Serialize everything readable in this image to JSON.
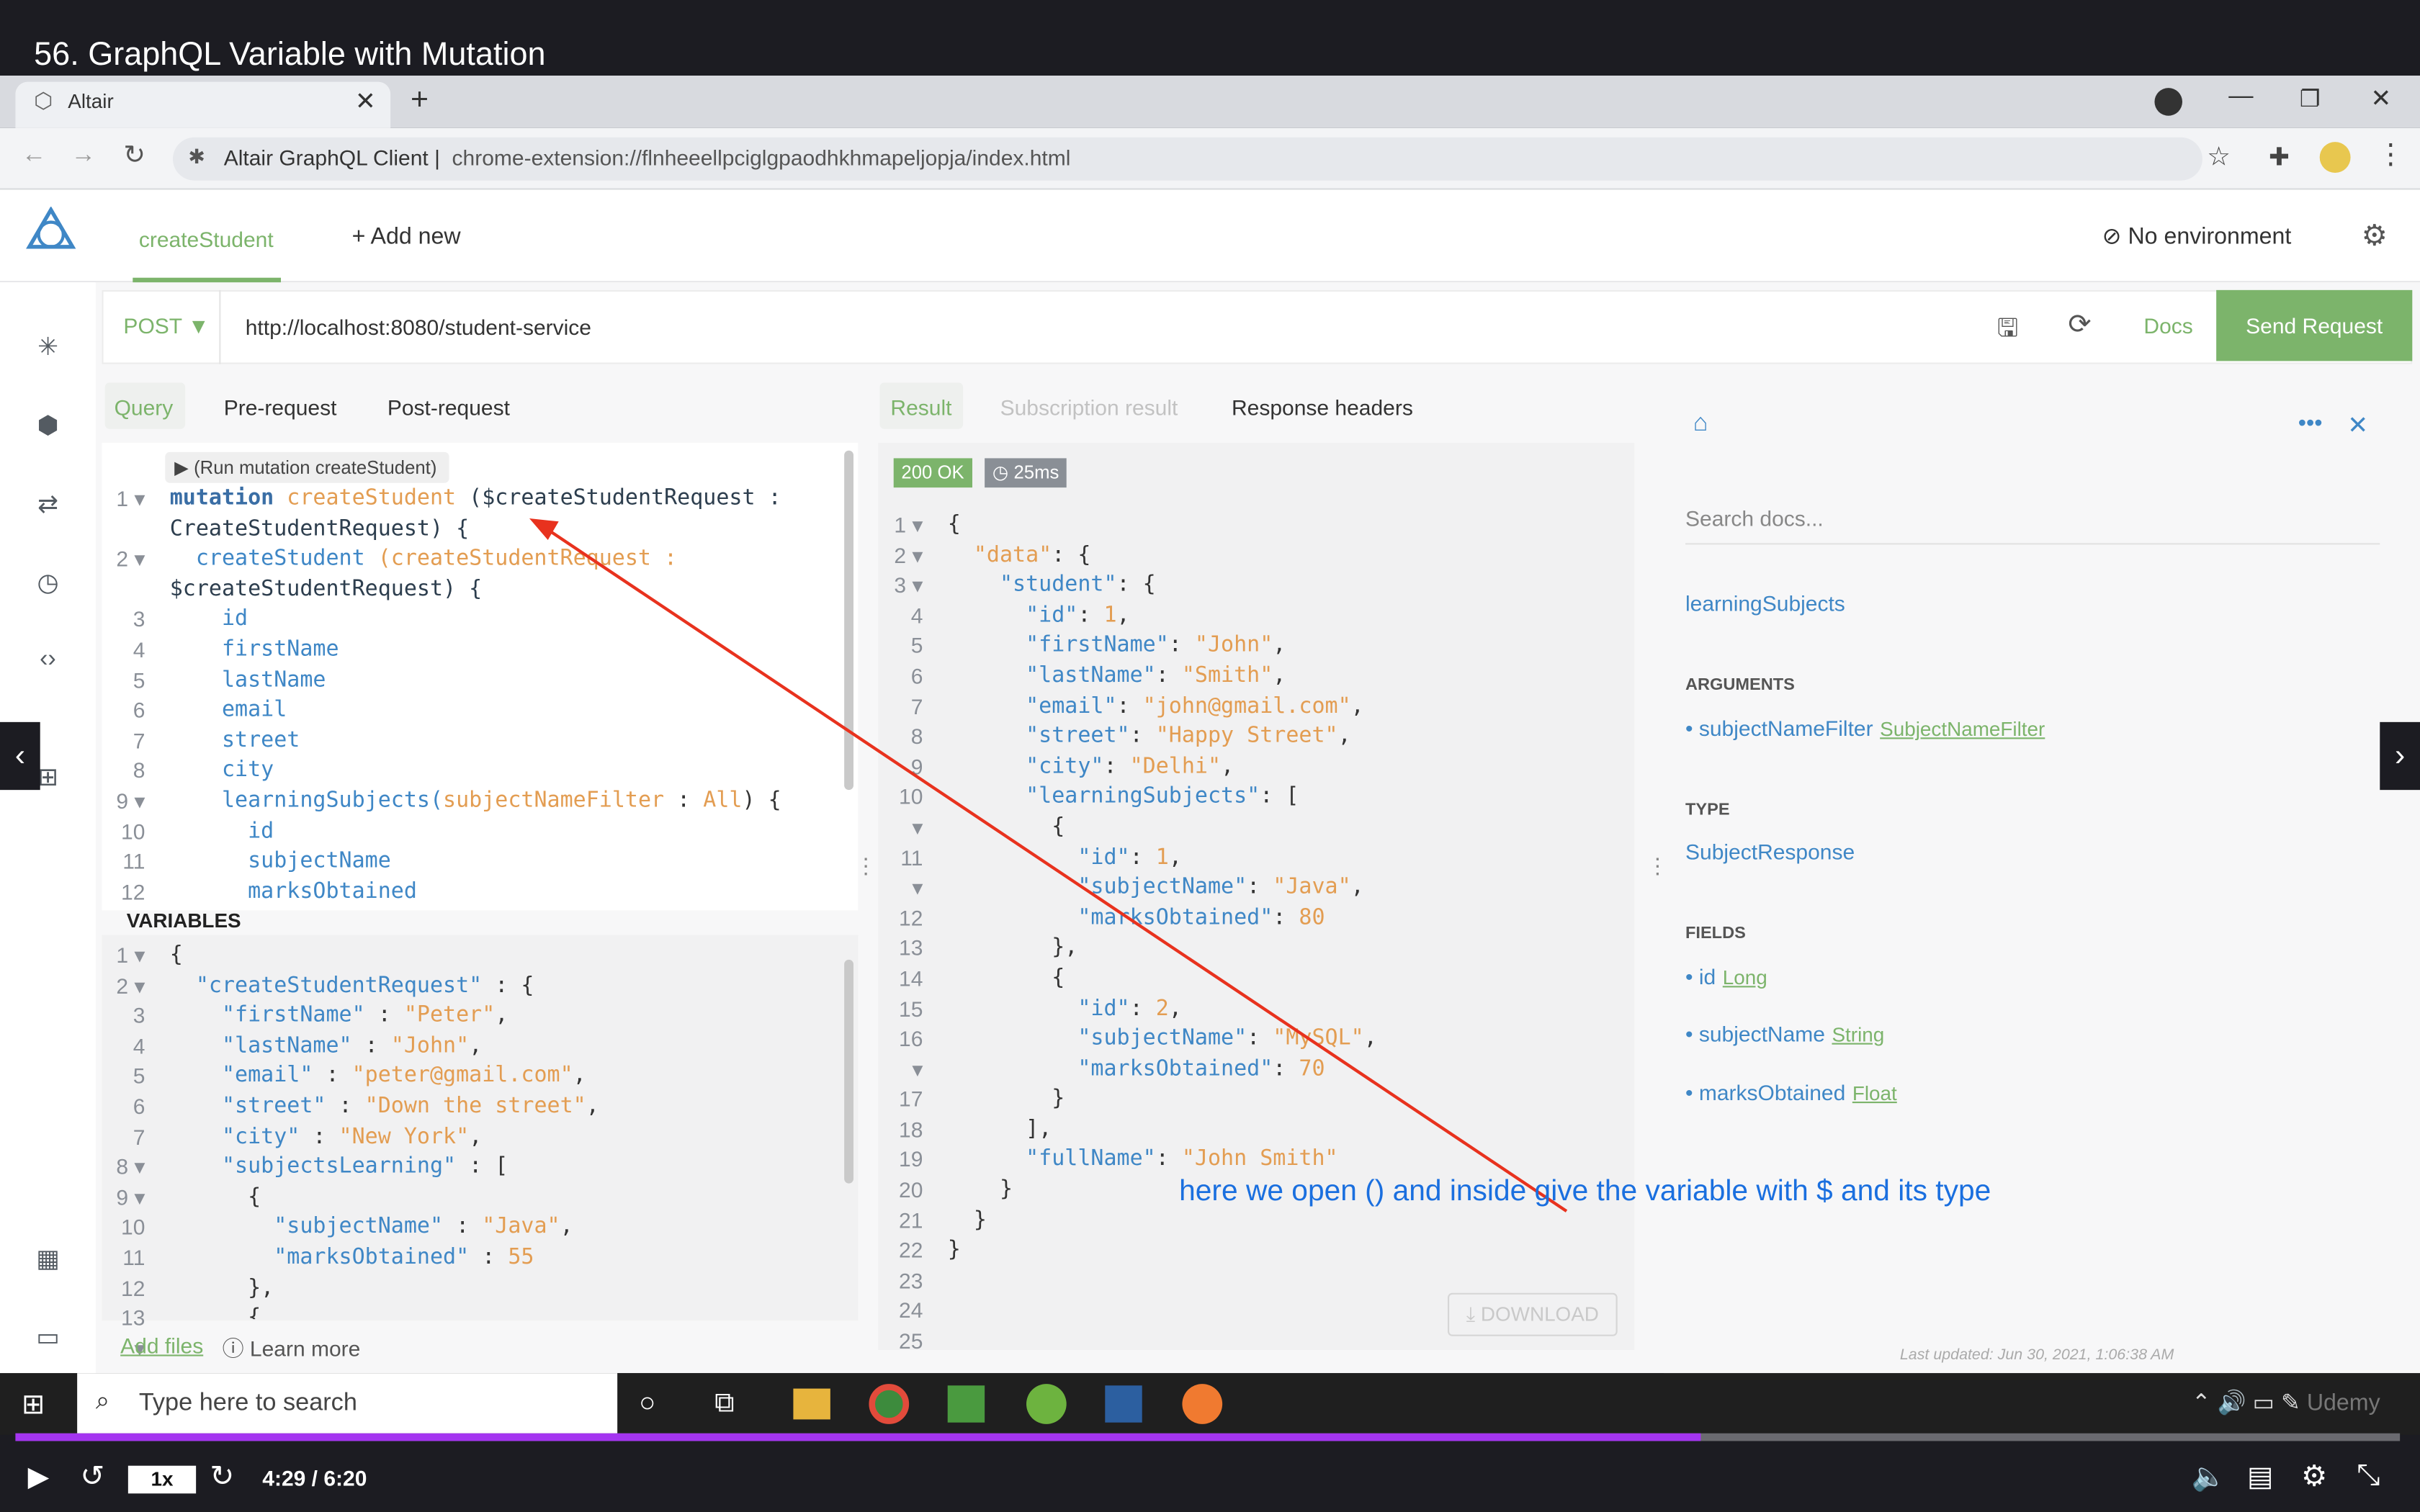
{
  "video": {
    "title": "56. GraphQL Variable with Mutation"
  },
  "browser": {
    "tab_title": "Altair",
    "site_label": "Altair GraphQL Client",
    "url": "chrome-extension://flnheeellpciglgpaodhkhmapeljopja/index.html"
  },
  "app": {
    "window_tab": "createStudent",
    "add_new": "+ Add new",
    "environment": "No environment",
    "method": "POST",
    "endpoint": "http://localhost:8080/student-service",
    "docs": "Docs",
    "send": "Send Request",
    "left_tabs": [
      "Query",
      "Pre-request",
      "Post-request"
    ],
    "right_tabs": [
      "Result",
      "Subscription result",
      "Response headers"
    ],
    "run_hint": "(Run mutation createStudent)",
    "variables_label": "VARIABLES",
    "add_files": "Add files",
    "learn_more": "Learn more",
    "status": "200 OK",
    "time": "25ms",
    "download": "DOWNLOAD"
  },
  "query_lines": [
    [
      {
        "t": "mutation ",
        "c": "kw"
      },
      {
        "t": "createStudent ",
        "c": "fn"
      },
      {
        "t": "($createStudentRequest :",
        "c": "var"
      }
    ],
    [
      {
        "t": "CreateStudentRequest) {",
        "c": "var"
      }
    ],
    [
      {
        "t": "  createStudent ",
        "c": "fld"
      },
      {
        "t": "(createStudentRequest :",
        "c": "fn"
      }
    ],
    [
      {
        "t": "$createStudentRequest) {",
        "c": "var"
      }
    ],
    [
      {
        "t": "    id",
        "c": "fld"
      }
    ],
    [
      {
        "t": "    firstName",
        "c": "fld"
      }
    ],
    [
      {
        "t": "    lastName",
        "c": "fld"
      }
    ],
    [
      {
        "t": "    email",
        "c": "fld"
      }
    ],
    [
      {
        "t": "    street",
        "c": "fld"
      }
    ],
    [
      {
        "t": "    city",
        "c": "fld"
      }
    ],
    [
      {
        "t": "    learningSubjects(",
        "c": "fld"
      },
      {
        "t": "subjectNameFilter",
        "c": "fn"
      },
      {
        "t": " : ",
        "c": "pn"
      },
      {
        "t": "All",
        "c": "fn"
      },
      {
        "t": ") {",
        "c": "pn"
      }
    ],
    [
      {
        "t": "      id",
        "c": "fld"
      }
    ],
    [
      {
        "t": "      subjectName",
        "c": "fld"
      }
    ],
    [
      {
        "t": "      marksObtained",
        "c": "fld"
      }
    ]
  ],
  "query_gutter": [
    "1 ▾",
    "",
    "2 ▾",
    "",
    "3",
    "4",
    "5",
    "6",
    "7",
    "8",
    "9 ▾",
    "10",
    "11",
    "12"
  ],
  "var_lines": [
    [
      {
        "t": "{",
        "c": "pn"
      }
    ],
    [
      {
        "t": "  \"createStudentRequest\"",
        "c": "key"
      },
      {
        "t": " : {",
        "c": "pn"
      }
    ],
    [
      {
        "t": "    \"firstName\"",
        "c": "key"
      },
      {
        "t": " : ",
        "c": "pn"
      },
      {
        "t": "\"Peter\"",
        "c": "str"
      },
      {
        "t": ",",
        "c": "pn"
      }
    ],
    [
      {
        "t": "    \"lastName\"",
        "c": "key"
      },
      {
        "t": " : ",
        "c": "pn"
      },
      {
        "t": "\"John\"",
        "c": "str"
      },
      {
        "t": ",",
        "c": "pn"
      }
    ],
    [
      {
        "t": "    \"email\"",
        "c": "key"
      },
      {
        "t": " : ",
        "c": "pn"
      },
      {
        "t": "\"peter@gmail.com\"",
        "c": "str"
      },
      {
        "t": ",",
        "c": "pn"
      }
    ],
    [
      {
        "t": "    \"street\"",
        "c": "key"
      },
      {
        "t": " : ",
        "c": "pn"
      },
      {
        "t": "\"Down the street\"",
        "c": "str"
      },
      {
        "t": ",",
        "c": "pn"
      }
    ],
    [
      {
        "t": "    \"city\"",
        "c": "key"
      },
      {
        "t": " : ",
        "c": "pn"
      },
      {
        "t": "\"New York\"",
        "c": "str"
      },
      {
        "t": ",",
        "c": "pn"
      }
    ],
    [
      {
        "t": "    \"subjectsLearning\"",
        "c": "key"
      },
      {
        "t": " : [",
        "c": "pn"
      }
    ],
    [
      {
        "t": "      {",
        "c": "pn"
      }
    ],
    [
      {
        "t": "        \"subjectName\"",
        "c": "key"
      },
      {
        "t": " : ",
        "c": "pn"
      },
      {
        "t": "\"Java\"",
        "c": "str"
      },
      {
        "t": ",",
        "c": "pn"
      }
    ],
    [
      {
        "t": "        \"marksObtained\"",
        "c": "key"
      },
      {
        "t": " : ",
        "c": "pn"
      },
      {
        "t": "55",
        "c": "num"
      }
    ],
    [
      {
        "t": "      },",
        "c": "pn"
      }
    ],
    [
      {
        "t": "      {",
        "c": "pn"
      }
    ]
  ],
  "var_gutter": [
    "1 ▾",
    "2 ▾",
    "3",
    "4",
    "5",
    "6",
    "7",
    "8 ▾",
    "9 ▾",
    "10",
    "11",
    "12",
    "13 ▾"
  ],
  "result_lines": [
    [
      {
        "t": "{",
        "c": "pn"
      }
    ],
    [
      {
        "t": "  \"data\"",
        "c": "str"
      },
      {
        "t": ": {",
        "c": "pn"
      }
    ],
    [
      {
        "t": "    \"student\"",
        "c": "key"
      },
      {
        "t": ": {",
        "c": "pn"
      }
    ],
    [
      {
        "t": "      \"id\"",
        "c": "key"
      },
      {
        "t": ": ",
        "c": "pn"
      },
      {
        "t": "1",
        "c": "num"
      },
      {
        "t": ",",
        "c": "pn"
      }
    ],
    [
      {
        "t": "      \"firstName\"",
        "c": "key"
      },
      {
        "t": ": ",
        "c": "pn"
      },
      {
        "t": "\"John\"",
        "c": "str"
      },
      {
        "t": ",",
        "c": "pn"
      }
    ],
    [
      {
        "t": "      \"lastName\"",
        "c": "key"
      },
      {
        "t": ": ",
        "c": "pn"
      },
      {
        "t": "\"Smith\"",
        "c": "str"
      },
      {
        "t": ",",
        "c": "pn"
      }
    ],
    [
      {
        "t": "      \"email\"",
        "c": "key"
      },
      {
        "t": ": ",
        "c": "pn"
      },
      {
        "t": "\"john@gmail.com\"",
        "c": "str"
      },
      {
        "t": ",",
        "c": "pn"
      }
    ],
    [
      {
        "t": "      \"street\"",
        "c": "key"
      },
      {
        "t": ": ",
        "c": "pn"
      },
      {
        "t": "\"Happy Street\"",
        "c": "str"
      },
      {
        "t": ",",
        "c": "pn"
      }
    ],
    [
      {
        "t": "      \"city\"",
        "c": "key"
      },
      {
        "t": ": ",
        "c": "pn"
      },
      {
        "t": "\"Delhi\"",
        "c": "str"
      },
      {
        "t": ",",
        "c": "pn"
      }
    ],
    [
      {
        "t": "      \"learningSubjects\"",
        "c": "key"
      },
      {
        "t": ": [",
        "c": "pn"
      }
    ],
    [
      {
        "t": "        {",
        "c": "pn"
      }
    ],
    [
      {
        "t": "          \"id\"",
        "c": "key"
      },
      {
        "t": ": ",
        "c": "pn"
      },
      {
        "t": "1",
        "c": "num"
      },
      {
        "t": ",",
        "c": "pn"
      }
    ],
    [
      {
        "t": "          \"subjectName\"",
        "c": "key"
      },
      {
        "t": ": ",
        "c": "pn"
      },
      {
        "t": "\"Java\"",
        "c": "str"
      },
      {
        "t": ",",
        "c": "pn"
      }
    ],
    [
      {
        "t": "          \"marksObtained\"",
        "c": "key"
      },
      {
        "t": ": ",
        "c": "pn"
      },
      {
        "t": "80",
        "c": "num"
      }
    ],
    [
      {
        "t": "        },",
        "c": "pn"
      }
    ],
    [
      {
        "t": "        {",
        "c": "pn"
      }
    ],
    [
      {
        "t": "          \"id\"",
        "c": "key"
      },
      {
        "t": ": ",
        "c": "pn"
      },
      {
        "t": "2",
        "c": "num"
      },
      {
        "t": ",",
        "c": "pn"
      }
    ],
    [
      {
        "t": "          \"subjectName\"",
        "c": "key"
      },
      {
        "t": ": ",
        "c": "pn"
      },
      {
        "t": "\"MySQL\"",
        "c": "str"
      },
      {
        "t": ",",
        "c": "pn"
      }
    ],
    [
      {
        "t": "          \"marksObtained\"",
        "c": "key"
      },
      {
        "t": ": ",
        "c": "pn"
      },
      {
        "t": "70",
        "c": "num"
      }
    ],
    [
      {
        "t": "        }",
        "c": "pn"
      }
    ],
    [
      {
        "t": "      ],",
        "c": "pn"
      }
    ],
    [
      {
        "t": "      \"fullName\"",
        "c": "key"
      },
      {
        "t": ": ",
        "c": "pn"
      },
      {
        "t": "\"John Smith\"",
        "c": "str"
      }
    ],
    [
      {
        "t": "    }",
        "c": "pn"
      }
    ],
    [
      {
        "t": "  }",
        "c": "pn"
      }
    ],
    [
      {
        "t": "}",
        "c": "pn"
      }
    ]
  ],
  "result_gutter": [
    "1 ▾",
    "2 ▾",
    "3 ▾",
    "4",
    "5",
    "6",
    "7",
    "8",
    "9",
    "10 ▾",
    "11 ▾",
    "12",
    "13",
    "14",
    "15",
    "16 ▾",
    "17",
    "18",
    "19",
    "20",
    "21",
    "22",
    "23",
    "24",
    "25"
  ],
  "docs_panel": {
    "search_placeholder": "Search docs...",
    "field_name": "learningSubjects",
    "arguments_heading": "ARGUMENTS",
    "arg_name": "subjectNameFilter",
    "arg_type": "SubjectNameFilter",
    "type_heading": "TYPE",
    "type_name": "SubjectResponse",
    "fields_heading": "FIELDS",
    "fields": [
      {
        "name": "id",
        "type": "Long"
      },
      {
        "name": "subjectName",
        "type": "String"
      },
      {
        "name": "marksObtained",
        "type": "Float"
      }
    ],
    "last_updated": "Last updated: Jun 30, 2021, 1:06:38 AM"
  },
  "annotation": "here we open () and inside give the variable with $ and its type",
  "taskbar": {
    "search_placeholder": "Type here to search",
    "tray_label": "Udemy"
  },
  "player": {
    "speed": "1x",
    "time": "4:29 / 6:20",
    "progress": 0.707
  },
  "colors": {
    "accent": "#7cb46b",
    "link": "#3f87c6",
    "annotation": "#e8321e",
    "progress": "#a435f0"
  }
}
